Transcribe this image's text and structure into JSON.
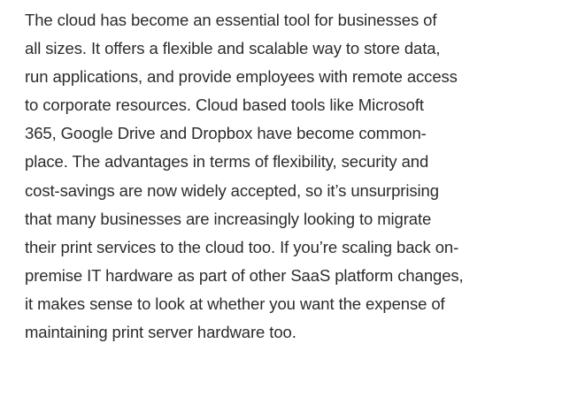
{
  "article": {
    "paragraph": [
      "The cloud has become an essential tool for businesses of",
      "all sizes. It offers a flexible and scalable way to store data,",
      "run applications, and provide employees with remote access",
      "to corporate resources. Cloud based tools like Microsoft",
      "365, Google Drive and Dropbox have become common-",
      "place. The advantages in terms of flexibility, security and",
      "cost-savings are now widely accepted, so it’s unsurprising",
      "that many businesses are increasingly looking to migrate",
      "their print services to the cloud too. If you’re scaling back on-",
      "premise IT hardware as part of other SaaS platform changes,",
      "it makes sense to look at whether you want the expense of",
      "maintaining print server hardware too."
    ]
  }
}
